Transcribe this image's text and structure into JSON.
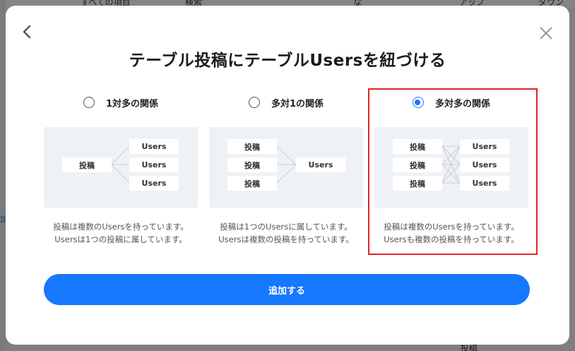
{
  "background": {
    "top_items": [
      "すべての項目",
      "検索",
      "な",
      "アップ",
      "ダウン"
    ],
    "left_mark": "加",
    "bottom_text": "投稿"
  },
  "modal": {
    "title": "テーブル投稿にテーブルUsersを紐づける",
    "options": [
      {
        "label": "1対多の関係",
        "selected": false,
        "left_boxes": [
          "投稿"
        ],
        "right_boxes": [
          "Users",
          "Users",
          "Users"
        ],
        "description_line1": "投稿は複数のUsersを持っています。",
        "description_line2": "Usersは1つの投稿に属しています。"
      },
      {
        "label": "多対1の関係",
        "selected": false,
        "left_boxes": [
          "投稿",
          "投稿",
          "投稿"
        ],
        "right_boxes": [
          "Users"
        ],
        "description_line1": "投稿は1つのUsersに属しています。",
        "description_line2": "Usersは複数の投稿を持っています。"
      },
      {
        "label": "多対多の関係",
        "selected": true,
        "left_boxes": [
          "投稿",
          "投稿",
          "投稿"
        ],
        "right_boxes": [
          "Users",
          "Users",
          "Users"
        ],
        "description_line1": "投稿は複数のUsersを持っています。",
        "description_line2": "Usersも複数の投稿を持っています。"
      }
    ],
    "submit_label": "追加する"
  },
  "colors": {
    "accent": "#1677ff",
    "highlight_border": "#e02424",
    "diagram_bg": "#eef1f5"
  },
  "icons": {
    "back": "chevron-left-icon",
    "close": "close-icon"
  }
}
